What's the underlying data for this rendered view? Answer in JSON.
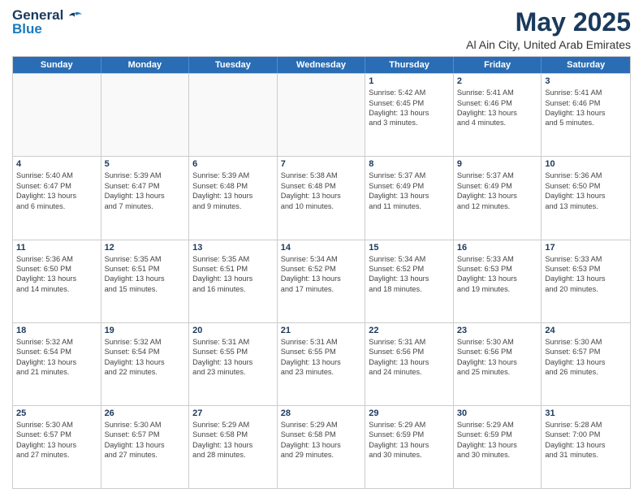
{
  "logo": {
    "line1": "General",
    "line2": "Blue"
  },
  "title": "May 2025",
  "location": "Al Ain City, United Arab Emirates",
  "days_of_week": [
    "Sunday",
    "Monday",
    "Tuesday",
    "Wednesday",
    "Thursday",
    "Friday",
    "Saturday"
  ],
  "weeks": [
    [
      {
        "day": "",
        "lines": [],
        "empty": true
      },
      {
        "day": "",
        "lines": [],
        "empty": true
      },
      {
        "day": "",
        "lines": [],
        "empty": true
      },
      {
        "day": "",
        "lines": [],
        "empty": true
      },
      {
        "day": "1",
        "lines": [
          "Sunrise: 5:42 AM",
          "Sunset: 6:45 PM",
          "Daylight: 13 hours",
          "and 3 minutes."
        ],
        "empty": false
      },
      {
        "day": "2",
        "lines": [
          "Sunrise: 5:41 AM",
          "Sunset: 6:46 PM",
          "Daylight: 13 hours",
          "and 4 minutes."
        ],
        "empty": false
      },
      {
        "day": "3",
        "lines": [
          "Sunrise: 5:41 AM",
          "Sunset: 6:46 PM",
          "Daylight: 13 hours",
          "and 5 minutes."
        ],
        "empty": false
      }
    ],
    [
      {
        "day": "4",
        "lines": [
          "Sunrise: 5:40 AM",
          "Sunset: 6:47 PM",
          "Daylight: 13 hours",
          "and 6 minutes."
        ],
        "empty": false
      },
      {
        "day": "5",
        "lines": [
          "Sunrise: 5:39 AM",
          "Sunset: 6:47 PM",
          "Daylight: 13 hours",
          "and 7 minutes."
        ],
        "empty": false
      },
      {
        "day": "6",
        "lines": [
          "Sunrise: 5:39 AM",
          "Sunset: 6:48 PM",
          "Daylight: 13 hours",
          "and 9 minutes."
        ],
        "empty": false
      },
      {
        "day": "7",
        "lines": [
          "Sunrise: 5:38 AM",
          "Sunset: 6:48 PM",
          "Daylight: 13 hours",
          "and 10 minutes."
        ],
        "empty": false
      },
      {
        "day": "8",
        "lines": [
          "Sunrise: 5:37 AM",
          "Sunset: 6:49 PM",
          "Daylight: 13 hours",
          "and 11 minutes."
        ],
        "empty": false
      },
      {
        "day": "9",
        "lines": [
          "Sunrise: 5:37 AM",
          "Sunset: 6:49 PM",
          "Daylight: 13 hours",
          "and 12 minutes."
        ],
        "empty": false
      },
      {
        "day": "10",
        "lines": [
          "Sunrise: 5:36 AM",
          "Sunset: 6:50 PM",
          "Daylight: 13 hours",
          "and 13 minutes."
        ],
        "empty": false
      }
    ],
    [
      {
        "day": "11",
        "lines": [
          "Sunrise: 5:36 AM",
          "Sunset: 6:50 PM",
          "Daylight: 13 hours",
          "and 14 minutes."
        ],
        "empty": false
      },
      {
        "day": "12",
        "lines": [
          "Sunrise: 5:35 AM",
          "Sunset: 6:51 PM",
          "Daylight: 13 hours",
          "and 15 minutes."
        ],
        "empty": false
      },
      {
        "day": "13",
        "lines": [
          "Sunrise: 5:35 AM",
          "Sunset: 6:51 PM",
          "Daylight: 13 hours",
          "and 16 minutes."
        ],
        "empty": false
      },
      {
        "day": "14",
        "lines": [
          "Sunrise: 5:34 AM",
          "Sunset: 6:52 PM",
          "Daylight: 13 hours",
          "and 17 minutes."
        ],
        "empty": false
      },
      {
        "day": "15",
        "lines": [
          "Sunrise: 5:34 AM",
          "Sunset: 6:52 PM",
          "Daylight: 13 hours",
          "and 18 minutes."
        ],
        "empty": false
      },
      {
        "day": "16",
        "lines": [
          "Sunrise: 5:33 AM",
          "Sunset: 6:53 PM",
          "Daylight: 13 hours",
          "and 19 minutes."
        ],
        "empty": false
      },
      {
        "day": "17",
        "lines": [
          "Sunrise: 5:33 AM",
          "Sunset: 6:53 PM",
          "Daylight: 13 hours",
          "and 20 minutes."
        ],
        "empty": false
      }
    ],
    [
      {
        "day": "18",
        "lines": [
          "Sunrise: 5:32 AM",
          "Sunset: 6:54 PM",
          "Daylight: 13 hours",
          "and 21 minutes."
        ],
        "empty": false
      },
      {
        "day": "19",
        "lines": [
          "Sunrise: 5:32 AM",
          "Sunset: 6:54 PM",
          "Daylight: 13 hours",
          "and 22 minutes."
        ],
        "empty": false
      },
      {
        "day": "20",
        "lines": [
          "Sunrise: 5:31 AM",
          "Sunset: 6:55 PM",
          "Daylight: 13 hours",
          "and 23 minutes."
        ],
        "empty": false
      },
      {
        "day": "21",
        "lines": [
          "Sunrise: 5:31 AM",
          "Sunset: 6:55 PM",
          "Daylight: 13 hours",
          "and 23 minutes."
        ],
        "empty": false
      },
      {
        "day": "22",
        "lines": [
          "Sunrise: 5:31 AM",
          "Sunset: 6:56 PM",
          "Daylight: 13 hours",
          "and 24 minutes."
        ],
        "empty": false
      },
      {
        "day": "23",
        "lines": [
          "Sunrise: 5:30 AM",
          "Sunset: 6:56 PM",
          "Daylight: 13 hours",
          "and 25 minutes."
        ],
        "empty": false
      },
      {
        "day": "24",
        "lines": [
          "Sunrise: 5:30 AM",
          "Sunset: 6:57 PM",
          "Daylight: 13 hours",
          "and 26 minutes."
        ],
        "empty": false
      }
    ],
    [
      {
        "day": "25",
        "lines": [
          "Sunrise: 5:30 AM",
          "Sunset: 6:57 PM",
          "Daylight: 13 hours",
          "and 27 minutes."
        ],
        "empty": false
      },
      {
        "day": "26",
        "lines": [
          "Sunrise: 5:30 AM",
          "Sunset: 6:57 PM",
          "Daylight: 13 hours",
          "and 27 minutes."
        ],
        "empty": false
      },
      {
        "day": "27",
        "lines": [
          "Sunrise: 5:29 AM",
          "Sunset: 6:58 PM",
          "Daylight: 13 hours",
          "and 28 minutes."
        ],
        "empty": false
      },
      {
        "day": "28",
        "lines": [
          "Sunrise: 5:29 AM",
          "Sunset: 6:58 PM",
          "Daylight: 13 hours",
          "and 29 minutes."
        ],
        "empty": false
      },
      {
        "day": "29",
        "lines": [
          "Sunrise: 5:29 AM",
          "Sunset: 6:59 PM",
          "Daylight: 13 hours",
          "and 30 minutes."
        ],
        "empty": false
      },
      {
        "day": "30",
        "lines": [
          "Sunrise: 5:29 AM",
          "Sunset: 6:59 PM",
          "Daylight: 13 hours",
          "and 30 minutes."
        ],
        "empty": false
      },
      {
        "day": "31",
        "lines": [
          "Sunrise: 5:28 AM",
          "Sunset: 7:00 PM",
          "Daylight: 13 hours",
          "and 31 minutes."
        ],
        "empty": false
      }
    ]
  ]
}
